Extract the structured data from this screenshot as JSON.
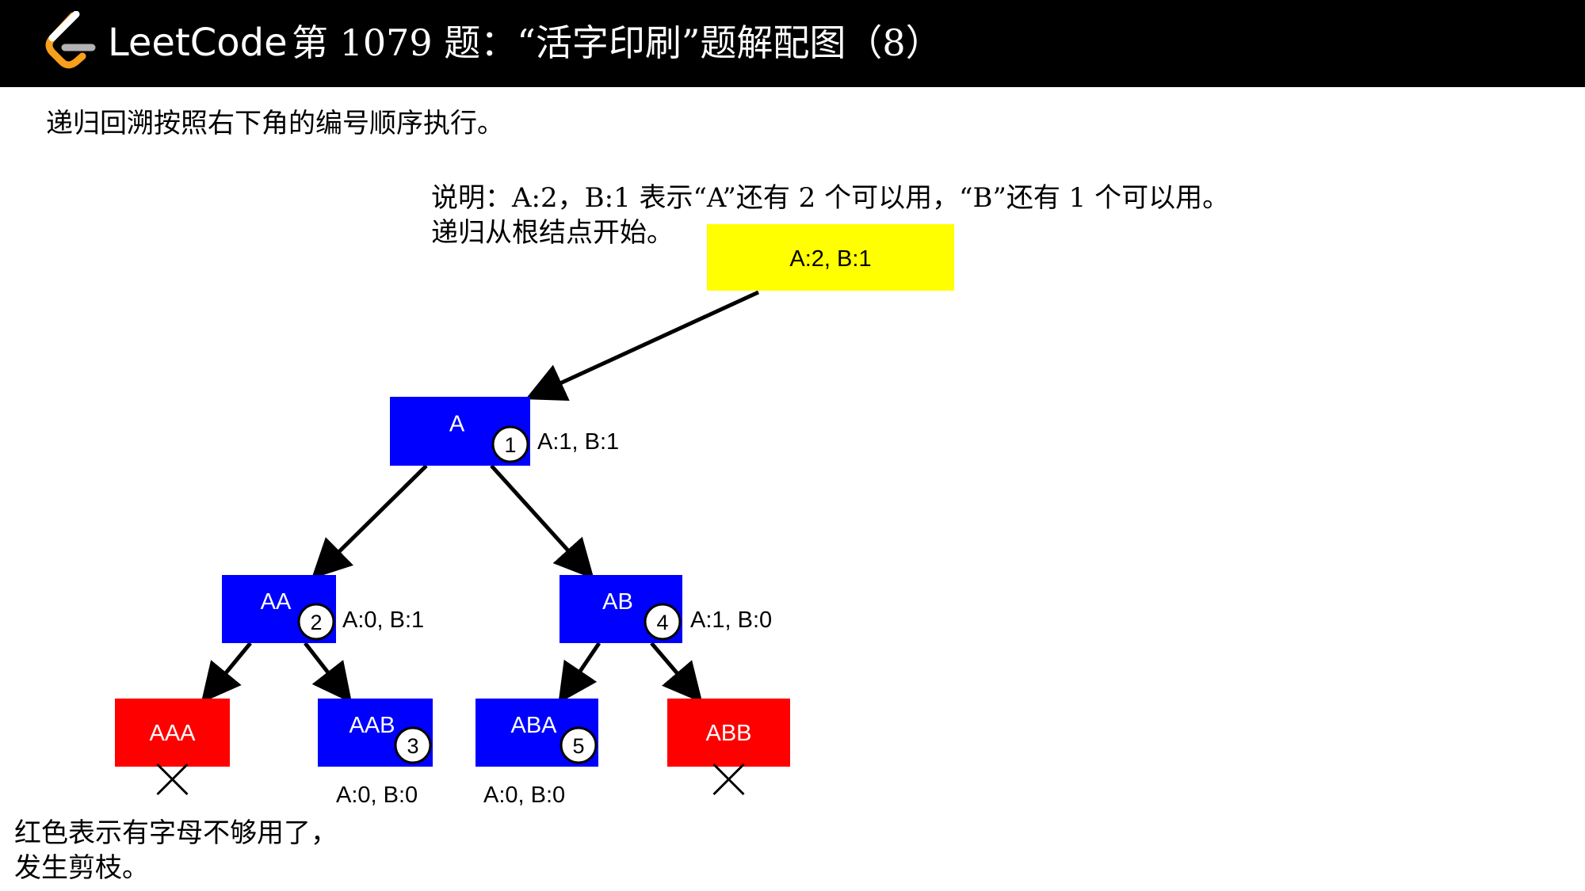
{
  "header": {
    "brand": "LeetCode",
    "title": "第 1079 题：“活字印刷”题解配图（8）"
  },
  "text": {
    "intro": "递归回溯按照右下角的编号顺序执行。",
    "explain_line1": "说明：A:2，B:1 表示“A”还有 2 个可以用，“B”还有 1 个可以用。",
    "explain_line2": "递归从根结点开始。",
    "note_line1": "红色表示有字母不够用了，",
    "note_line2": "发生剪枝。"
  },
  "colors": {
    "root": "#ffff00",
    "active": "#0000ff",
    "pruned": "#ff0000",
    "header_bg": "#000000",
    "logo_orange": "#f89f1b",
    "logo_gray": "#b3b3b3"
  },
  "tree": {
    "root": {
      "label": "A:2, B:1"
    },
    "nodes": [
      {
        "id": "A",
        "label": "A",
        "order": "1",
        "counts": "A:1, B:1",
        "state": "active"
      },
      {
        "id": "AA",
        "label": "AA",
        "order": "2",
        "counts": "A:0, B:1",
        "state": "active"
      },
      {
        "id": "AB",
        "label": "AB",
        "order": "4",
        "counts": "A:1, B:0",
        "state": "active"
      },
      {
        "id": "AAA",
        "label": "AAA",
        "state": "pruned",
        "mark": "cross-icon"
      },
      {
        "id": "AAB",
        "label": "AAB",
        "order": "3",
        "counts": "A:0, B:0",
        "state": "active"
      },
      {
        "id": "ABA",
        "label": "ABA",
        "order": "5",
        "counts": "A:0, B:0",
        "state": "active"
      },
      {
        "id": "ABB",
        "label": "ABB",
        "state": "pruned",
        "mark": "cross-icon"
      }
    ],
    "edges": [
      [
        "root",
        "A"
      ],
      [
        "A",
        "AA"
      ],
      [
        "A",
        "AB"
      ],
      [
        "AA",
        "AAA"
      ],
      [
        "AA",
        "AAB"
      ],
      [
        "AB",
        "ABA"
      ],
      [
        "AB",
        "ABB"
      ]
    ]
  }
}
